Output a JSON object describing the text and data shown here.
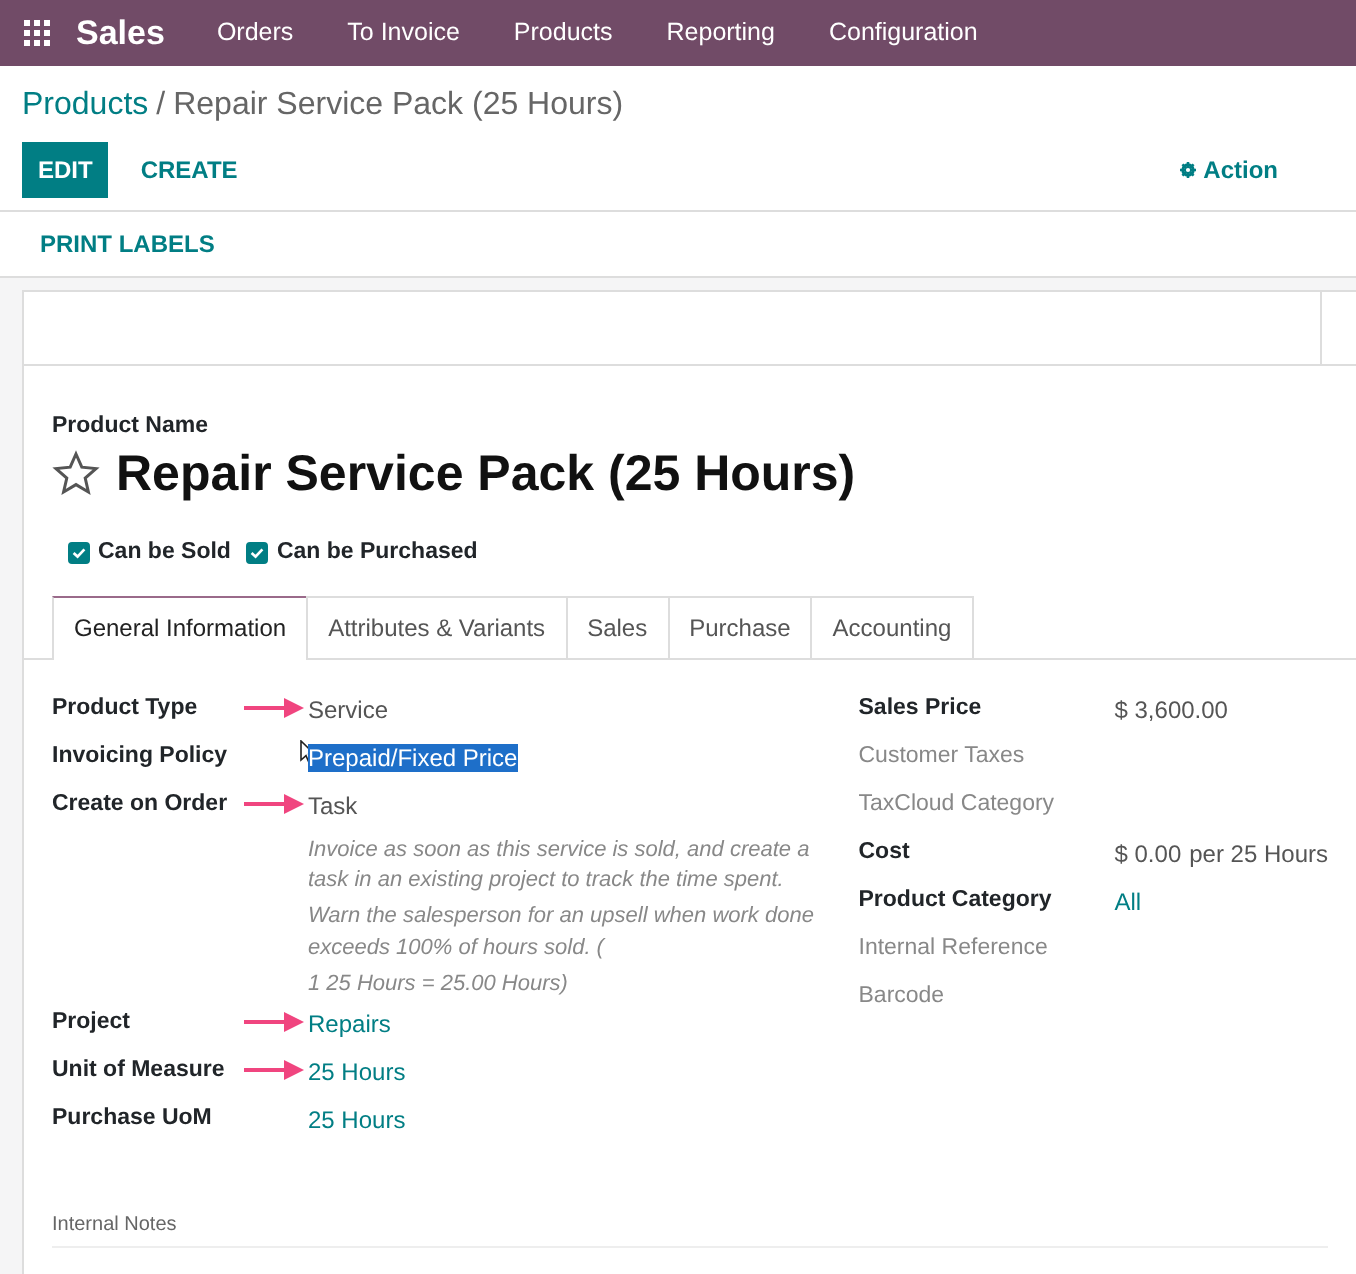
{
  "app": {
    "name": "Sales",
    "menu": [
      "Orders",
      "To Invoice",
      "Products",
      "Reporting",
      "Configuration"
    ]
  },
  "breadcrumb": {
    "parent": "Products",
    "separator": "/",
    "current": "Repair Service Pack (25 Hours)"
  },
  "buttons": [
    {
      "label": "EDIT",
      "kind": "primary"
    },
    {
      "label": "CREATE",
      "kind": "link"
    }
  ],
  "action": "Action",
  "print_labels": "PRINT LABELS",
  "product": {
    "name_label": "Product Name",
    "name": "Repair Service Pack (25 Hours)",
    "favorite": false
  },
  "options": [
    {
      "label": "Can be Sold",
      "checked": true
    },
    {
      "label": "Can be Purchased",
      "checked": true
    }
  ],
  "tabs": [
    {
      "label": "General Information",
      "selected": true
    },
    {
      "label": "Attributes & Variants",
      "selected": false
    },
    {
      "label": "Sales",
      "selected": false
    },
    {
      "label": "Purchase",
      "selected": false
    },
    {
      "label": "Accounting",
      "selected": false
    }
  ],
  "left_fields": [
    {
      "label": "Product Type",
      "value": "Service",
      "kind": "text",
      "arrow": true
    },
    {
      "label": "Invoicing Policy",
      "value": "Prepaid/Fixed Price",
      "kind": "highlighted",
      "arrow": false
    },
    {
      "label": "Create on Order",
      "value": "Task",
      "kind": "text",
      "arrow": true
    },
    {
      "kind": "help",
      "lines": [
        "Invoice as soon as this service is sold, and create a task in an existing project to track the time spent.",
        "Warn the salesperson for an upsell when work done exceeds 100% of hours sold. (",
        "1 25 Hours = 25.00 Hours)"
      ]
    },
    {
      "label": "Project",
      "value": "Repairs",
      "kind": "link",
      "arrow": true
    },
    {
      "label": "Unit of Measure",
      "value": "25 Hours",
      "kind": "link",
      "arrow": true
    },
    {
      "label": "Purchase UoM",
      "value": "25 Hours",
      "kind": "link",
      "arrow": false
    }
  ],
  "right_fields": [
    {
      "label": "Sales Price",
      "filled": true,
      "value": "$ 3,600.00",
      "kind": "text"
    },
    {
      "label": "Customer Taxes",
      "filled": false
    },
    {
      "label": "TaxCloud Category",
      "filled": false
    },
    {
      "label": "Cost",
      "filled": true,
      "value": "$ 0.00",
      "suffix": "per 25 Hours",
      "kind": "text"
    },
    {
      "label": "Product Category",
      "filled": true,
      "value": "All",
      "kind": "link"
    },
    {
      "label": "Internal Reference",
      "filled": false
    },
    {
      "label": "Barcode",
      "filled": false
    }
  ],
  "internal_notes": "Internal Notes"
}
